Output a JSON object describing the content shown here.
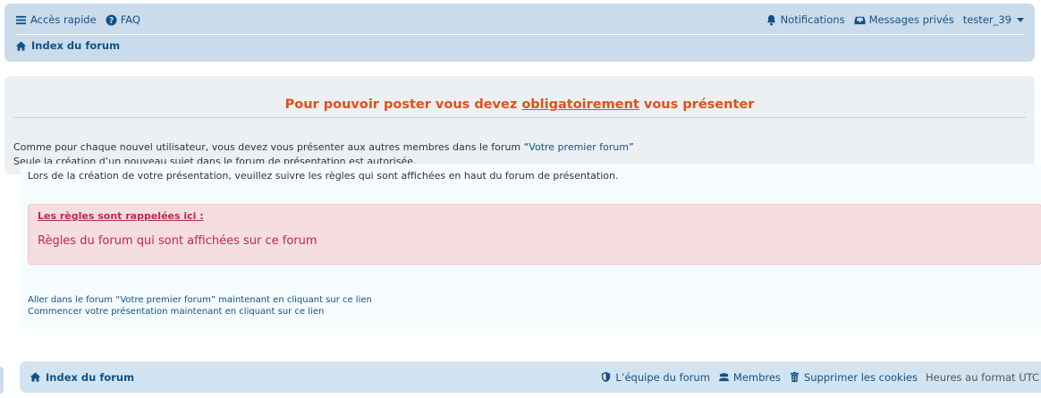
{
  "navbar": {
    "quick_access": "Accès rapide",
    "faq": "FAQ",
    "notifications": "Notifications",
    "private_messages": "Messages privés",
    "username": "tester_39",
    "breadcrumb": "Index du forum"
  },
  "panel": {
    "title_before": "Pour pouvoir poster vous devez ",
    "title_emphasis": "obligatoirement",
    "title_after": " vous présenter",
    "line1_before": "Comme pour chaque nouvel utilisateur, vous devez vous présenter aux autres membres dans le forum “",
    "line1_link": "Votre premier forum",
    "line1_after": "”",
    "line2": "Seule la création d’un nouveau sujet dans le forum de présentation est autorisée."
  },
  "content": {
    "line": "Lors de la création de votre présentation, veuillez suivre les règles qui sont affichées en haut du forum de présentation.",
    "rules_heading": "Les règles sont rappelées ici :",
    "rules_text": "Règles du forum qui sont affichées sur ce forum",
    "link1": "Aller dans le forum “Votre premier forum” maintenant en cliquant sur ce lien",
    "link2": "Commencer votre présentation maintenant en cliquant sur ce lien"
  },
  "footer": {
    "breadcrumb": "Index du forum",
    "team": "L’équipe du forum",
    "members": "Membres",
    "delete_cookies": "Supprimer les cookies",
    "timezone": "Heures au format UTC"
  },
  "icons": {
    "quick_access": "bars-icon",
    "faq": "question-circle-icon",
    "notifications": "bell-icon",
    "messages": "inbox-icon",
    "home": "home-icon",
    "team": "shield-icon",
    "members": "users-icon",
    "trash": "trash-icon"
  },
  "colors": {
    "navbar_bg": "#cadceb",
    "accent_title": "#e2501a",
    "link": "#105289",
    "rules_text": "#bc2a4d",
    "rules_bg": "#f6dde0"
  }
}
